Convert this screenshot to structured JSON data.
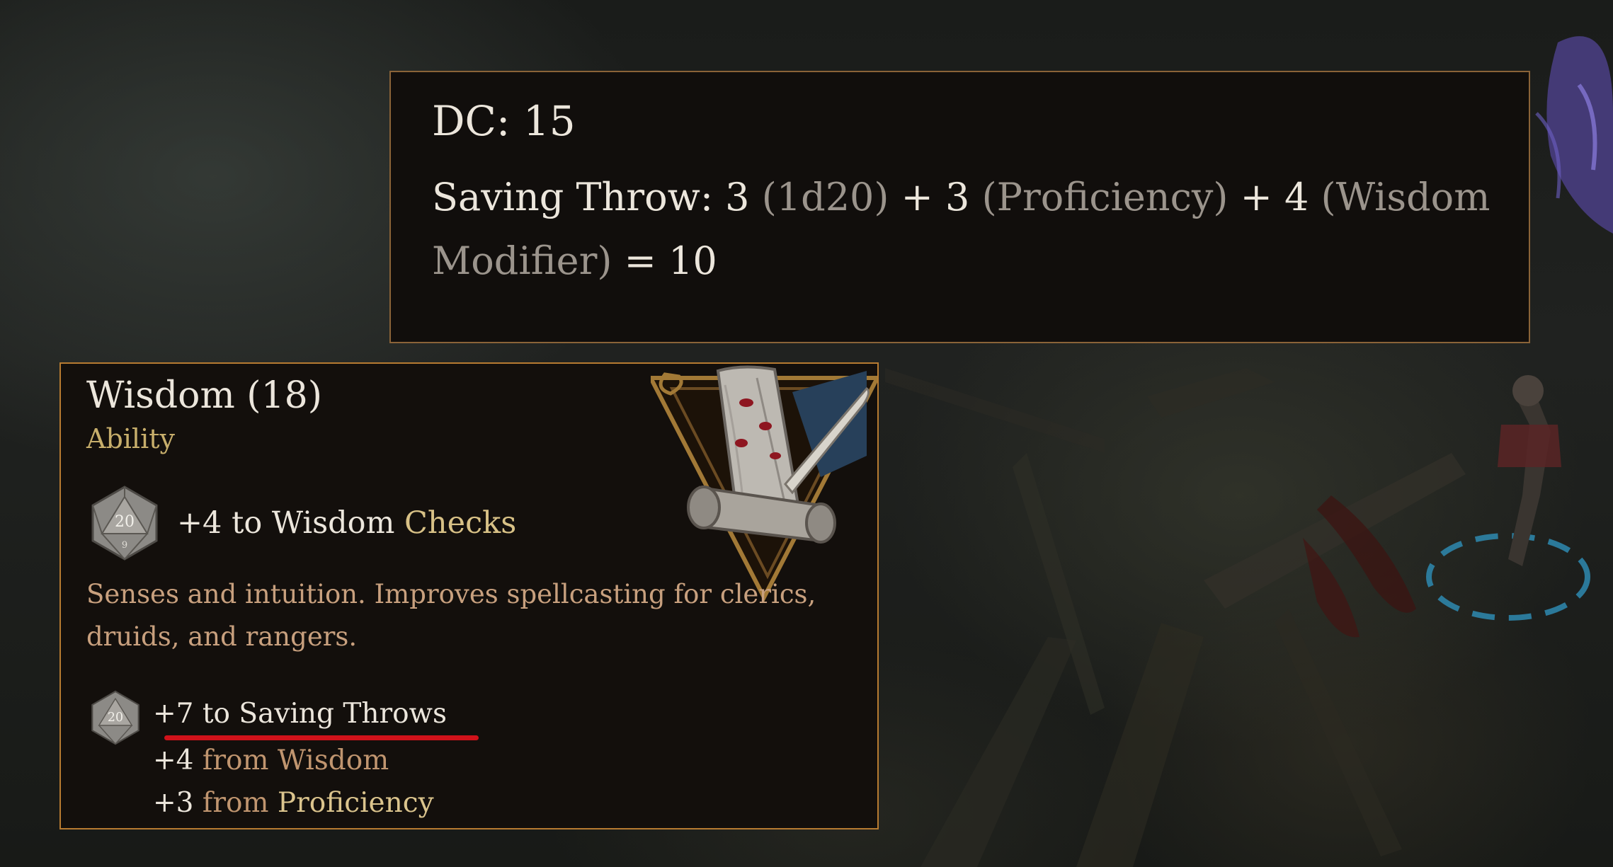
{
  "roll_tooltip": {
    "dc_label": "DC: 15",
    "formula_parts": {
      "p1": "Saving Throw: 3 ",
      "p2": "(1d20)",
      "p3": " + 3 ",
      "p4": "(Proficiency)",
      "p5": " + 4 ",
      "p6": "(Wisdom Modifier)",
      "p7": " = 10"
    }
  },
  "wisdom_tooltip": {
    "title": "Wisdom (18)",
    "subtitle": "Ability",
    "check_bonus": "+4",
    "check_text_pre": "to Wisdom",
    "check_text_keyword": "Checks",
    "description": "Senses and intuition. Improves spellcasting for clerics, druids, and rangers.",
    "saving_throw_total": "+7 to Saving Throws",
    "breakdown": [
      {
        "value": "+4",
        "source_word": "from",
        "source": "Wisdom"
      },
      {
        "value": "+3",
        "source_word": "from",
        "source": "Proficiency"
      }
    ],
    "die_label": "20",
    "die_sub": "9"
  },
  "colors": {
    "panel_border_top": "#8a6338",
    "panel_border_wisdom": "#b77b31",
    "annotation_underline": "#d0121a",
    "gold_text": "#c7ae6b",
    "muted_text": "#9b948c"
  }
}
